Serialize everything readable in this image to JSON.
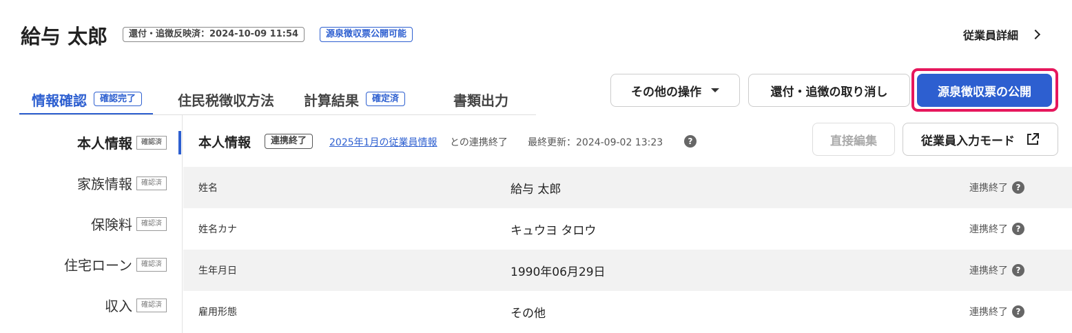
{
  "header": {
    "employee_name": "給与 太郎",
    "reflect_badge": "還付・追徴反映済：2024-10-09 11:54",
    "status_badge": "源泉徴収票公開可能",
    "detail_link": "従業員詳細"
  },
  "tabs": [
    {
      "label": "情報確認",
      "badge": "確認完了",
      "active": true
    },
    {
      "label": "住民税徴収方法",
      "badge": ""
    },
    {
      "label": "計算結果",
      "badge": "確定済"
    },
    {
      "label": "書類出力",
      "badge": ""
    }
  ],
  "actions": {
    "other_ops": "その他の操作",
    "cancel_refund": "還付・追徴の取り消し",
    "publish": "源泉徴収票の公開"
  },
  "sidebar": {
    "items": [
      {
        "label": "本人情報",
        "badge": "確認済"
      },
      {
        "label": "家族情報",
        "badge": "確認済"
      },
      {
        "label": "保険料",
        "badge": "確認済"
      },
      {
        "label": "住宅ローン",
        "badge": "確認済"
      },
      {
        "label": "収入",
        "badge": "確認済"
      }
    ]
  },
  "section": {
    "title": "本人情報",
    "badge": "連携終了",
    "link_text": "2025年1月の従業員情報",
    "link_suffix": "との連携終了",
    "last_updated": "最終更新：2024-09-02 13:23",
    "help": "?",
    "edit_button": "直接編集",
    "input_mode_button": "従業員入力モード"
  },
  "table": {
    "rows": [
      {
        "label": "姓名",
        "value": "給与 太郎",
        "status": "連携終了"
      },
      {
        "label": "姓名カナ",
        "value": "キュウヨ タロウ",
        "status": "連携終了"
      },
      {
        "label": "生年月日",
        "value": "1990年06月29日",
        "status": "連携終了"
      },
      {
        "label": "雇用形態",
        "value": "その他",
        "status": "連携終了"
      }
    ]
  },
  "colors": {
    "accent": "#2d5fd0",
    "highlight": "#e6175c"
  }
}
